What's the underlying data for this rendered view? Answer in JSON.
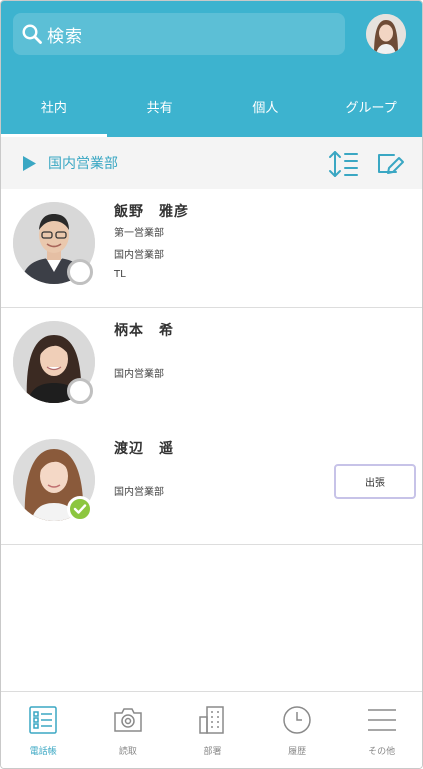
{
  "search": {
    "label": "検索"
  },
  "tabs": [
    {
      "label": "社内",
      "active": true
    },
    {
      "label": "共有",
      "active": false
    },
    {
      "label": "個人",
      "active": false
    },
    {
      "label": "グループ",
      "active": false
    }
  ],
  "department": {
    "name": "国内営業部"
  },
  "contacts": [
    {
      "name": "飯野　雅彦",
      "lines": [
        "第一営業部",
        "国内営業部",
        "TL"
      ],
      "status": "offline"
    },
    {
      "name": "柄本　希",
      "lines": [
        "国内営業部"
      ],
      "status": "offline"
    },
    {
      "name": "渡辺　遥",
      "lines": [
        "国内営業部"
      ],
      "status": "available",
      "badge": "出張"
    }
  ],
  "bottom_nav": [
    {
      "label": "電話帳",
      "icon": "phonebook-icon",
      "active": true
    },
    {
      "label": "読取",
      "icon": "camera-icon",
      "active": false
    },
    {
      "label": "部署",
      "icon": "building-icon",
      "active": false
    },
    {
      "label": "履歴",
      "icon": "clock-icon",
      "active": false
    },
    {
      "label": "その他",
      "icon": "menu-icon",
      "active": false
    }
  ],
  "colors": {
    "header": "#3db3cf",
    "accent": "#3aa7c3",
    "status_ok": "#8cc63f"
  }
}
